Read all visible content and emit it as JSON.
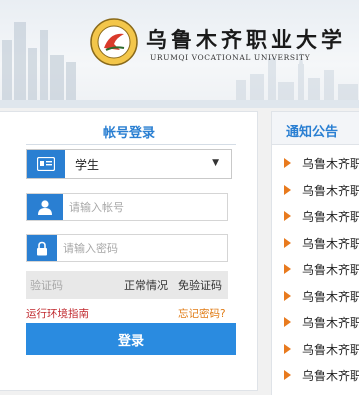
{
  "header": {
    "school_name_cn": "乌鲁木齐职业大学",
    "school_name_en": "URUMQI VOCATIONAL UNIVERSITY",
    "logo_icon": "university-logo-icon"
  },
  "login": {
    "title": "帐号登录",
    "role": {
      "icon": "id-card-icon",
      "value": "学生"
    },
    "username": {
      "icon": "user-icon",
      "placeholder": "请输入帐号"
    },
    "password": {
      "icon": "lock-icon",
      "placeholder": "请输入密码"
    },
    "captcha": {
      "placeholder": "验证码",
      "status": "正常情况",
      "skip": "免验证码"
    },
    "env_guide": "运行环境指南",
    "forgot": "忘记密码?",
    "submit": "登录"
  },
  "notices": {
    "title": "通知公告",
    "items": [
      {
        "text": "乌鲁木齐职"
      },
      {
        "text": "乌鲁木齐职"
      },
      {
        "text": "乌鲁木齐职"
      },
      {
        "text": "乌鲁木齐职"
      },
      {
        "text": "乌鲁木齐职"
      },
      {
        "text": "乌鲁木齐职"
      },
      {
        "text": "乌鲁木齐职"
      },
      {
        "text": "乌鲁木齐职"
      },
      {
        "text": "乌鲁木齐职"
      }
    ]
  },
  "colors": {
    "accent": "#2a7fd2",
    "button": "#2a8be0",
    "warning": "#c0282d",
    "link": "#e07b14",
    "bullet": "#e87a1e"
  }
}
